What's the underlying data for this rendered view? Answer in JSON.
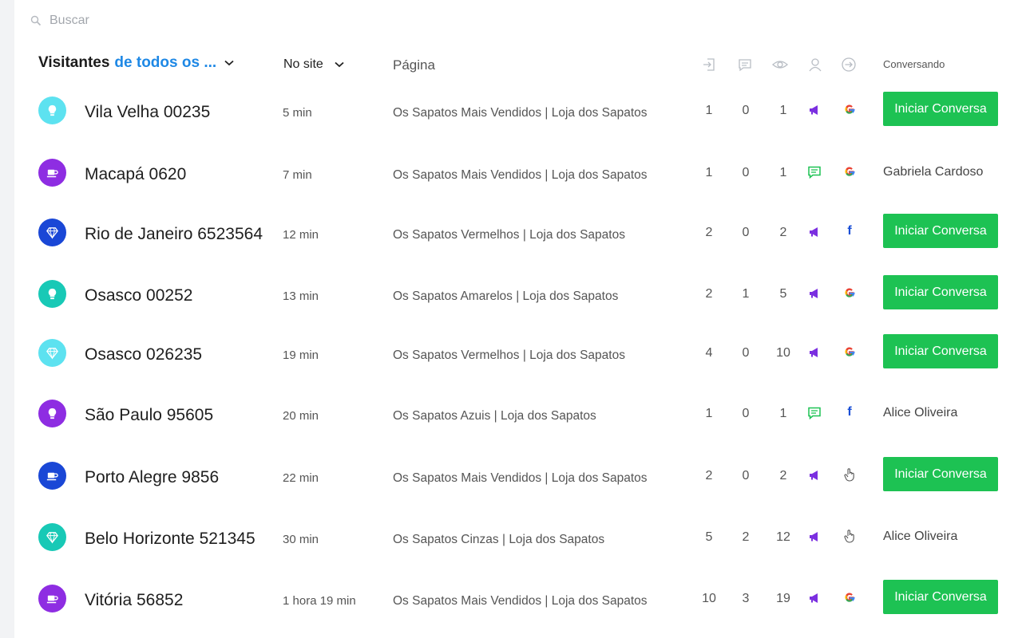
{
  "search": {
    "placeholder": "Buscar"
  },
  "header": {
    "title": "Visitantes",
    "title_filter": "de todos os ...",
    "on_site": "No site",
    "page": "Página",
    "conversing": "Conversando"
  },
  "header_icons": [
    "entry-icon",
    "message-icon",
    "eye-icon",
    "user-icon",
    "arrow-right-circle-icon"
  ],
  "colors": {
    "accent": "#1e88e5",
    "button_green": "#1dc253",
    "purple": "#7b2fe0",
    "chat_green": "#1dc253",
    "avatar_cyan": "#5de2f0",
    "avatar_purple": "#8e2de2",
    "avatar_blue": "#1a47d6",
    "avatar_teal": "#18c9b6"
  },
  "button_label": "Iniciar Conversa",
  "rows": [
    {
      "city": "Vila Velha 00235",
      "time": "5 min",
      "page": "Os Sapatos Mais Vendidos | Loja dos Sapatos",
      "a": "1",
      "b": "0",
      "c": "1",
      "status": "megaphone-icon",
      "source": "google-icon",
      "agent": "",
      "avatar_icon": "lightbulb-icon",
      "avatar_color": "#5de2f0"
    },
    {
      "city": "Macapá 0620",
      "time": "7 min",
      "page": "Os Sapatos Mais Vendidos | Loja dos Sapatos",
      "a": "1",
      "b": "0",
      "c": "1",
      "status": "chat-icon",
      "source": "google-icon",
      "agent": "Gabriela Cardoso",
      "avatar_icon": "coffee-icon",
      "avatar_color": "#8e2de2"
    },
    {
      "city": "Rio de Janeiro 6523564",
      "time": "12 min",
      "page": "Os Sapatos Vermelhos | Loja dos Sapatos",
      "a": "2",
      "b": "0",
      "c": "2",
      "status": "megaphone-icon",
      "source": "facebook-icon",
      "agent": "",
      "avatar_icon": "diamond-icon",
      "avatar_color": "#1a47d6"
    },
    {
      "city": "Osasco 00252",
      "time": "13 min",
      "page": "Os Sapatos Amarelos | Loja dos Sapatos",
      "a": "2",
      "b": "1",
      "c": "5",
      "status": "megaphone-icon",
      "source": "google-icon",
      "agent": "",
      "avatar_icon": "lightbulb-icon",
      "avatar_color": "#18c9b6"
    },
    {
      "city": "Osasco 026235",
      "time": "19 min",
      "page": "Os Sapatos Vermelhos | Loja dos Sapatos",
      "a": "4",
      "b": "0",
      "c": "10",
      "status": "megaphone-icon",
      "source": "google-icon",
      "agent": "",
      "avatar_icon": "diamond-icon",
      "avatar_color": "#5de2f0"
    },
    {
      "city": "São Paulo 95605",
      "time": "20 min",
      "page": "Os Sapatos Azuis | Loja dos Sapatos",
      "a": "1",
      "b": "0",
      "c": "1",
      "status": "chat-icon",
      "source": "facebook-icon",
      "agent": "Alice Oliveira",
      "avatar_icon": "lightbulb-icon",
      "avatar_color": "#8e2de2"
    },
    {
      "city": "Porto Alegre 9856",
      "time": "22 min",
      "page": "Os Sapatos Mais Vendidos | Loja dos Sapatos",
      "a": "2",
      "b": "0",
      "c": "2",
      "status": "megaphone-icon",
      "source": "pointer-hand-icon",
      "agent": "",
      "avatar_icon": "coffee-icon",
      "avatar_color": "#1a47d6"
    },
    {
      "city": "Belo Horizonte 521345",
      "time": "30 min",
      "page": "Os Sapatos Cinzas | Loja dos Sapatos",
      "a": "5",
      "b": "2",
      "c": "12",
      "status": "megaphone-icon",
      "source": "pointer-hand-icon",
      "agent": "Alice Oliveira",
      "avatar_icon": "diamond-icon",
      "avatar_color": "#18c9b6"
    },
    {
      "city": "Vitória 56852",
      "time": "1 hora 19 min",
      "page": "Os Sapatos Mais Vendidos | Loja dos Sapatos",
      "a": "10",
      "b": "3",
      "c": "19",
      "status": "megaphone-icon",
      "source": "google-icon",
      "agent": "",
      "avatar_icon": "coffee-icon",
      "avatar_color": "#8e2de2"
    }
  ]
}
